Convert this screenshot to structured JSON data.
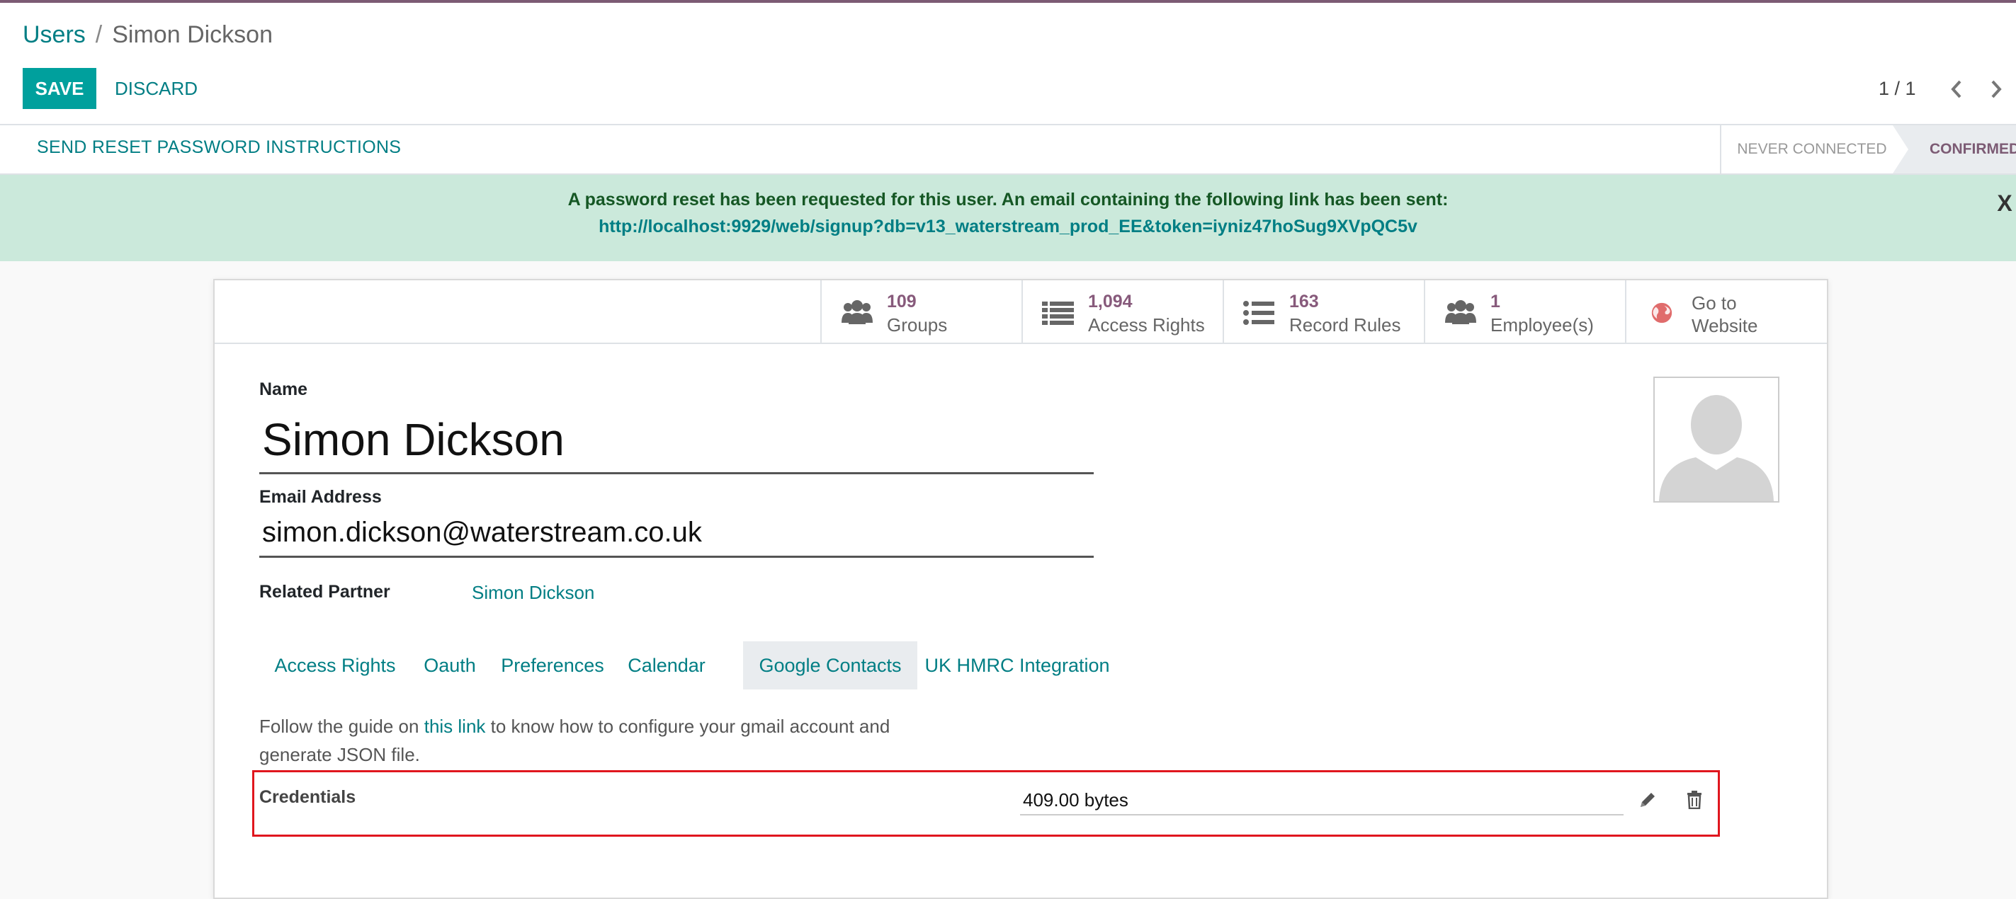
{
  "breadcrumb": {
    "parent": "Users",
    "separator": "/",
    "current": "Simon Dickson"
  },
  "toolbar": {
    "save_label": "SAVE",
    "discard_label": "DISCARD"
  },
  "pager": {
    "value": "1 / 1"
  },
  "statusbar": {
    "action_label": "SEND RESET PASSWORD INSTRUCTIONS",
    "states": [
      "NEVER CONNECTED",
      "CONFIRMED"
    ],
    "active_state": "CONFIRMED"
  },
  "alert": {
    "message": "A password reset has been requested for this user. An email containing the following link has been sent:",
    "link": "http://localhost:9929/web/signup?db=v13_waterstream_prod_EE&token=iyniz47hoSug9XVpQC5v",
    "close_label": "X"
  },
  "smart_buttons": [
    {
      "value": "109",
      "label": "Groups",
      "icon": "users-icon"
    },
    {
      "value": "1,094",
      "label": "Access Rights",
      "icon": "list-icon"
    },
    {
      "value": "163",
      "label": "Record Rules",
      "icon": "list-bullet-icon"
    },
    {
      "value": "1",
      "label": "Employee(s)",
      "icon": "users-icon"
    },
    {
      "line1": "Go to",
      "line2": "Website",
      "icon": "globe-icon"
    }
  ],
  "form": {
    "name_label": "Name",
    "name_value": "Simon Dickson",
    "email_label": "Email Address",
    "email_value": "simon.dickson@waterstream.co.uk",
    "partner_label": "Related Partner",
    "partner_value": "Simon Dickson"
  },
  "tabs": [
    {
      "label": "Access Rights",
      "active": false
    },
    {
      "label": "Oauth",
      "active": false
    },
    {
      "label": "Preferences",
      "active": false
    },
    {
      "label": "Calendar",
      "active": false
    },
    {
      "label": "Google Contacts",
      "active": true
    },
    {
      "label": "UK HMRC Integration",
      "active": false
    }
  ],
  "google_contacts": {
    "guide_prefix": "Follow the guide on ",
    "guide_link": "this link",
    "guide_suffix": " to know how to configure your gmail account and generate JSON file.",
    "credentials_label": "Credentials",
    "credentials_value": "409.00 bytes"
  },
  "colors": {
    "brand": "#875a7b",
    "accent": "#00a09d",
    "link": "#017e84",
    "alert_bg": "#cbe9db",
    "highlight_border": "#e0161e"
  }
}
